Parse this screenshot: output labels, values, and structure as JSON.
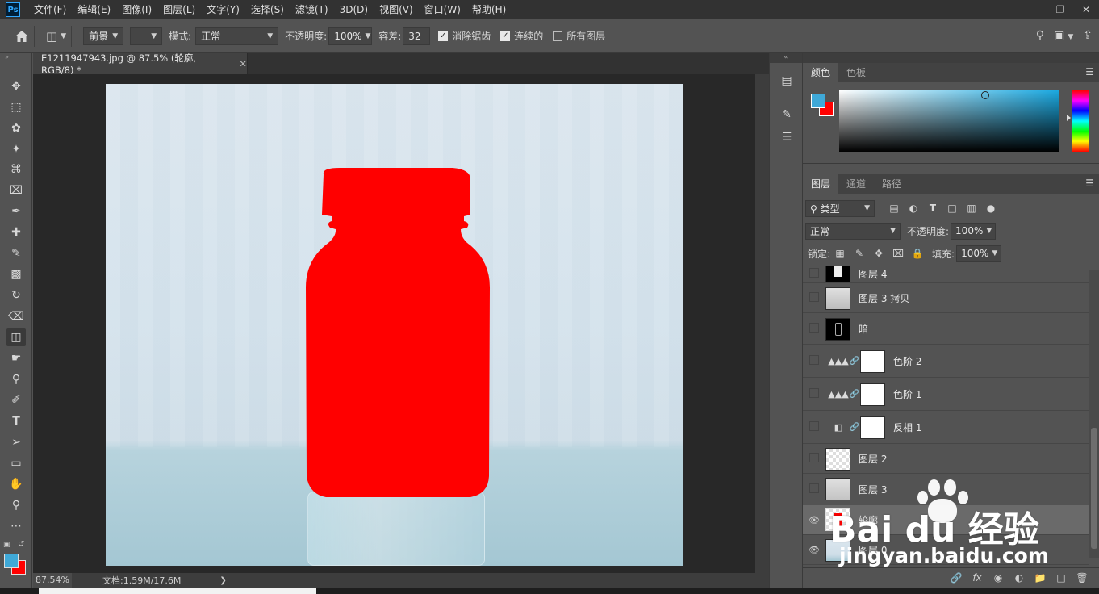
{
  "app": {
    "logo": "Ps"
  },
  "menu": [
    "文件(F)",
    "编辑(E)",
    "图像(I)",
    "图层(L)",
    "文字(Y)",
    "选择(S)",
    "滤镜(T)",
    "3D(D)",
    "视图(V)",
    "窗口(W)",
    "帮助(H)"
  ],
  "options": {
    "source": "前景",
    "mode_label": "模式:",
    "mode_value": "正常",
    "opacity_label": "不透明度:",
    "opacity_value": "100%",
    "tolerance_label": "容差:",
    "tolerance_value": "32",
    "antialias_label": "消除锯齿",
    "antialias_checked": true,
    "contiguous_label": "连续的",
    "contiguous_checked": true,
    "all_layers_label": "所有图层",
    "all_layers_checked": false
  },
  "document": {
    "tab_title": "E1211947943.jpg @ 87.5% (轮廓, RGB/8) *",
    "zoom": "87.54%",
    "doc_info": "文档:1.59M/17.6M"
  },
  "colors": {
    "foreground": "#3fa9d8",
    "background": "#ff0000",
    "fill": "#ff0000"
  },
  "color_panel": {
    "tabs": [
      "颜色",
      "色板"
    ],
    "active_tab": 0
  },
  "layers_panel": {
    "tabs": [
      "图层",
      "通道",
      "路径"
    ],
    "filter_kind": "类型",
    "blend_mode": "正常",
    "opacity_label": "不透明度:",
    "opacity_value": "100%",
    "lock_label": "锁定:",
    "fill_label": "填充:",
    "fill_value": "100%",
    "layers": [
      {
        "name": "图层 4",
        "visible": false,
        "type": "pixel",
        "thumb": "black"
      },
      {
        "name": "图层 3 拷贝",
        "visible": false,
        "type": "pixel",
        "thumb": "grey"
      },
      {
        "name": "暗",
        "visible": false,
        "type": "pixel",
        "thumb": "dark"
      },
      {
        "name": "色阶 2",
        "visible": false,
        "type": "adjustment",
        "adj_icon": "levels-icon"
      },
      {
        "name": "色阶 1",
        "visible": false,
        "type": "adjustment",
        "adj_icon": "levels-icon"
      },
      {
        "name": "反相 1",
        "visible": false,
        "type": "adjustment",
        "adj_icon": "invert-icon"
      },
      {
        "name": "图层 2",
        "visible": false,
        "type": "pixel",
        "thumb": "checker"
      },
      {
        "name": "图层 3",
        "visible": false,
        "type": "pixel",
        "thumb": "grey"
      },
      {
        "name": "轮廓",
        "visible": true,
        "type": "pixel",
        "thumb": "red",
        "selected": true
      },
      {
        "name": "图层 0",
        "visible": true,
        "type": "pixel",
        "thumb": "photo"
      }
    ]
  },
  "watermark": {
    "brand": "Bai du 经验",
    "url": "jingyan.baidu.com"
  }
}
